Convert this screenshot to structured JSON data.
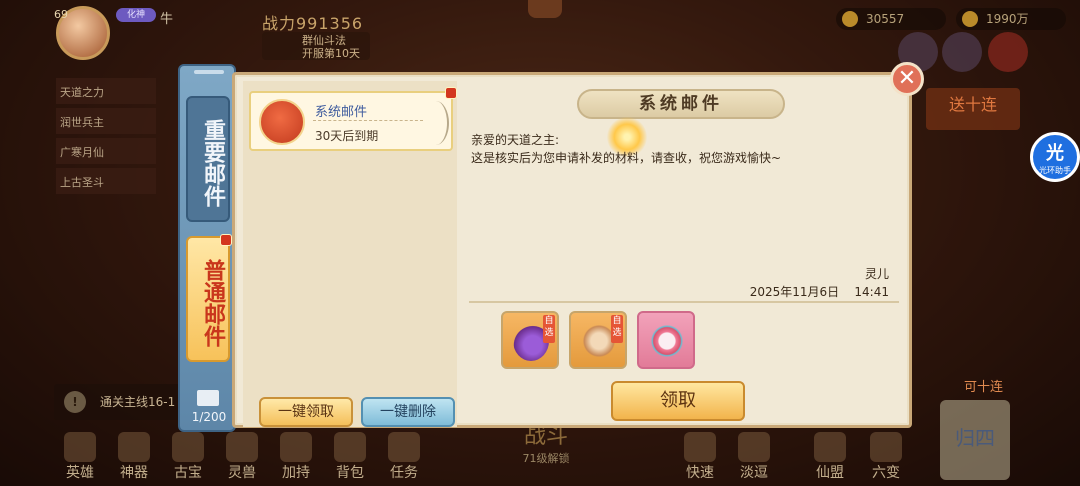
{
  "player": {
    "level": "69",
    "god_badge": "化神",
    "name": "牛",
    "power": "战力991356",
    "event_title": "群仙斗法",
    "event_sub": "开服第10天"
  },
  "resources": {
    "coins": "30557",
    "ingots": "1990万"
  },
  "left_strip": [
    "天道之力",
    "润世兵主",
    "广寒月仙",
    "上古圣斗"
  ],
  "right_buttons": {
    "ten_pull": "送十连",
    "assist_icon": "光",
    "assist_label": "光环助手",
    "can_pull": "可十连",
    "return": "归四"
  },
  "quest": {
    "text": "通关主线16-1"
  },
  "bottom_nav": [
    "英雄",
    "神器",
    "古宝",
    "灵兽",
    "加持",
    "背包",
    "任务",
    "快速",
    "淡逗",
    "仙盟",
    "六变"
  ],
  "battle": {
    "label": "战斗",
    "sub": "71级解锁"
  },
  "mail": {
    "tabs": {
      "important": "重要邮件",
      "normal": "普通邮件"
    },
    "count": "1/200",
    "list": [
      {
        "title": "系统邮件",
        "expiry": "30天后到期"
      }
    ],
    "claim_all": "一键领取",
    "delete_all": "一键删除",
    "detail": {
      "title": "系统邮件",
      "greeting": "亲爱的天道之主:",
      "body": "这是核实后为您申请补发的材料，请查收，祝您游戏愉快~",
      "sender": "灵儿",
      "date": "2025年11月6日",
      "time": "14:41",
      "optional_tag": "自选",
      "rewards": [
        "reward-purple-orb",
        "reward-lotus-chest",
        "reward-ring-pendant"
      ],
      "claim": "领取"
    },
    "close_icon": "close-icon"
  }
}
